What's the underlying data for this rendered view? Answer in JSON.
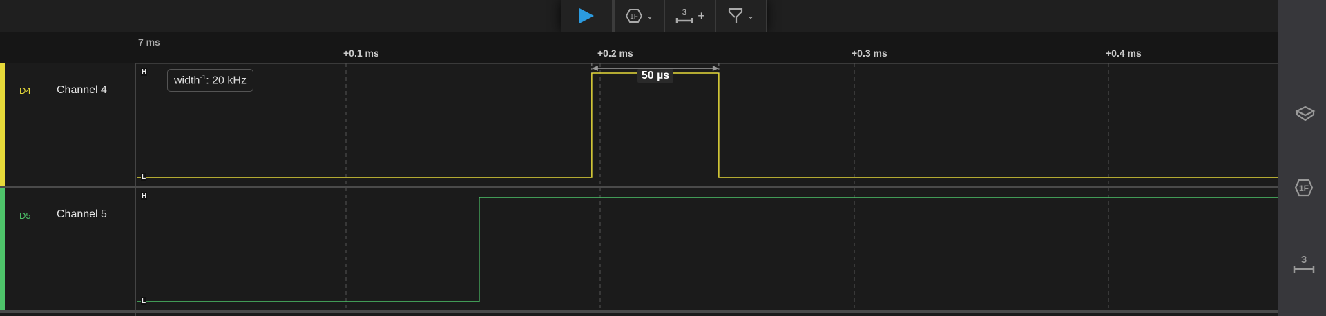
{
  "toolbar": {
    "play": "play-icon",
    "trigger_icon_text": "1F",
    "measure_icon_text": "3",
    "measure_add": "+"
  },
  "axis": {
    "origin_label": "7 ms",
    "ticks": [
      {
        "label": "+0.1 ms",
        "t": 0.1
      },
      {
        "label": "+0.2 ms",
        "t": 0.2
      },
      {
        "label": "+0.3 ms",
        "t": 0.3
      },
      {
        "label": "+0.4 ms",
        "t": 0.4
      }
    ]
  },
  "channels": [
    {
      "id": "D4",
      "name": "Channel 4",
      "color": "#e6d93a",
      "high": "H",
      "low": "L",
      "initial": 0,
      "transitions_ms": [
        0.1967,
        0.2467
      ]
    },
    {
      "id": "D5",
      "name": "Channel 5",
      "color": "#4ec46a",
      "high": "H",
      "low": "L",
      "initial": 0,
      "transitions_ms": [
        0.1524
      ]
    }
  ],
  "annotations": {
    "tooltip_prefix": "width",
    "tooltip_sup": "-1",
    "tooltip_value": ": 20 kHz",
    "measurement": "50 µs"
  },
  "sidebar": {
    "trigger_text": "1F",
    "measure_text": "3"
  },
  "colors": {
    "play": "#2b9be0"
  }
}
